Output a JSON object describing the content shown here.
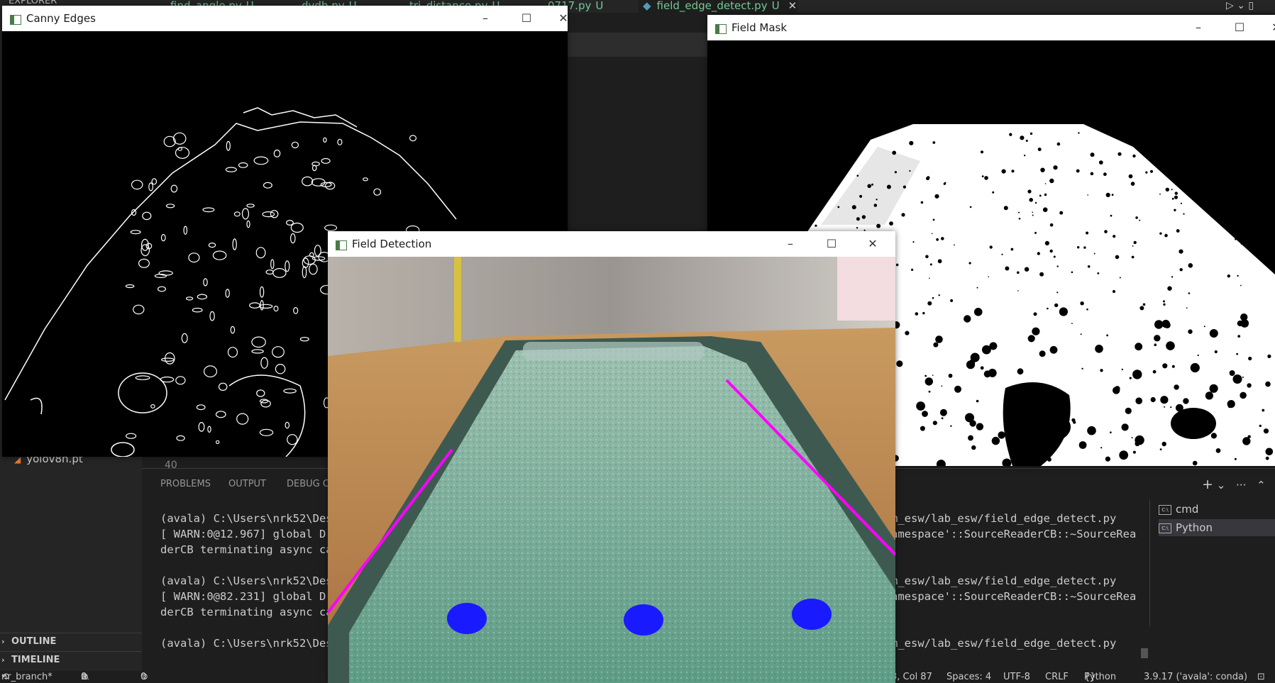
{
  "editor": {
    "tabs": [
      {
        "label": "find_angle.py",
        "status": "U"
      },
      {
        "label": "dydb.py",
        "status": "U"
      },
      {
        "label": "tri_distance.py",
        "status": "U"
      },
      {
        "label": "0717.py",
        "status": "U"
      },
      {
        "label": "field_edge_detect.py",
        "status": "U"
      }
    ],
    "explorer_label": "EXPLORER",
    "sidebar_file": "yolov8n.pt",
    "line_number": "40",
    "outline_label": "OUTLINE",
    "timeline_label": "TIMELINE"
  },
  "panel": {
    "tabs": [
      "PROBLEMS",
      "OUTPUT",
      "DEBUG CO"
    ],
    "terminal_left": [
      "(avala) C:\\Users\\nrk52\\Des",
      "[ WARN:0@12.967] global D:",
      "derCB terminating async ca",
      "",
      "(avala) C:\\Users\\nrk52\\Des",
      "[ WARN:0@82.231] global D:",
      "derCB terminating async ca",
      "",
      "(avala) C:\\Users\\nrk52\\Des"
    ],
    "terminal_right": [
      "m_esw/lab_esw/field_edge_detect.py",
      "amespace'::SourceReaderCB::~SourceRea",
      "",
      "",
      "m_esw/lab_esw/field_edge_detect.py",
      "amespace'::SourceReaderCB::~SourceRea",
      "",
      "",
      "m_esw/lab_esw/field_edge_detect.py"
    ],
    "terminals": [
      "cmd",
      "Python"
    ]
  },
  "statusbar": {
    "branch": "nr_branch*",
    "errors": "0",
    "warnings": "0",
    "ports": "0",
    "position": "3, Col 87",
    "spaces": "Spaces: 4",
    "encoding": "UTF-8",
    "eol": "CRLF",
    "language": "Python",
    "interpreter": "3.9.17 ('avala': conda)"
  },
  "windows": {
    "canny": {
      "title": "Canny Edges"
    },
    "mask": {
      "title": "Field Mask"
    },
    "detection": {
      "title": "Field Detection"
    }
  },
  "colors": {
    "edge_line": "#ff00ff",
    "ball": "#1a1aff"
  }
}
